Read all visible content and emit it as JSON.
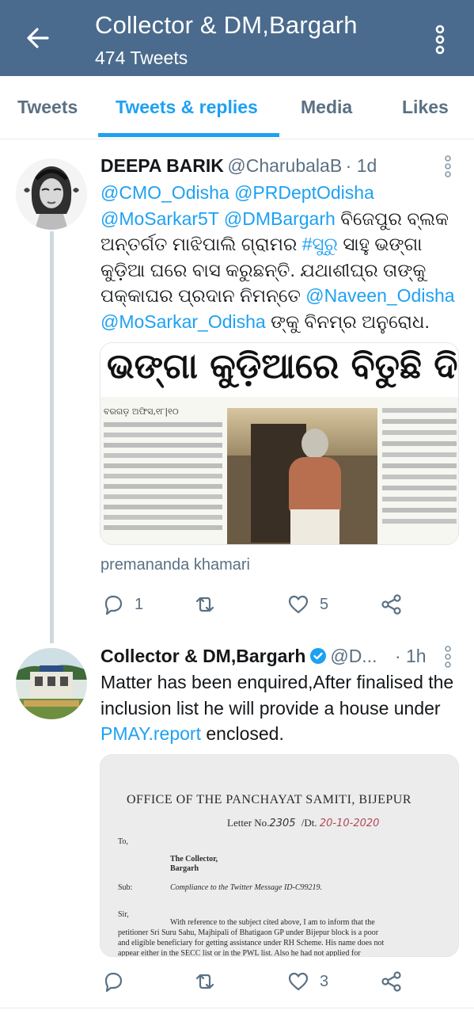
{
  "header": {
    "title": "Collector & DM,Bargarh",
    "subtitle": "474 Tweets"
  },
  "tabs": [
    {
      "label": "Tweets"
    },
    {
      "label": "Tweets & replies"
    },
    {
      "label": "Media"
    },
    {
      "label": "Likes"
    }
  ],
  "tweet1": {
    "name": "DEEPA BARIK",
    "handle": "@CharubalaB",
    "time": "· 1d",
    "body_parts": [
      {
        "text": "@CMO_Odisha",
        "link": true
      },
      {
        "text": " ",
        "link": false
      },
      {
        "text": "@PRDeptOdisha",
        "link": true
      },
      {
        "text": " ",
        "link": false
      },
      {
        "text": "@MoSarkar5T",
        "link": true
      },
      {
        "text": " ",
        "link": false
      },
      {
        "text": "@DMBargarh",
        "link": true
      },
      {
        "text": " ବିଜେପୁର ବ୍ଲକ ଅନ୍ତର୍ଗତ ମାଝିପାଲି ଗ୍ରାମର ",
        "link": false
      },
      {
        "text": "#ସୁରୁ",
        "link": true
      },
      {
        "text": " ସାହୁ ଭଙ୍ଗା କୁଡ଼ିଆ ଘରେ ବାସ କରୁଛନ୍ତି. ଯଥାଶୀଘ୍ର ତାଙ୍କୁ ପକ୍କାଘର ପ୍ରଦାନ ନିମନ୍ତେ ",
        "link": false
      },
      {
        "text": "@Naveen_Odisha",
        "link": true
      },
      {
        "text": " ",
        "link": false
      },
      {
        "text": "@MoSarkar_Odisha",
        "link": true
      },
      {
        "text": " ଙ୍କୁ ବିନମ୍ର ଅନୁରୋଧ.",
        "link": false
      }
    ],
    "image_headline": "ଭଙ୍ଗା କୁଡ଼ିଆରେ ବିତୁଛି ଦିନ",
    "image_dateline": "ବରଗଡ଼ ଅଫିସ,୧୮|୧୦",
    "caption": "premananda khamari",
    "replies": "1",
    "retweets": "",
    "likes": "5"
  },
  "tweet2": {
    "name": "Collector & DM,Bargarh",
    "handle": "@D...",
    "time": "· 1h",
    "body_parts": [
      {
        "text": "Matter has been enquired,After finalised the inclusion list he will provide a house under ",
        "link": false
      },
      {
        "text": "PMAY.report",
        "link": true
      },
      {
        "text": " enclosed.",
        "link": false
      }
    ],
    "doc": {
      "office": "OFFICE OF THE PANCHAYAT SAMITI, BIJEPUR",
      "letter": "Letter No.",
      "letter_no": "2305",
      "dt_label": "/Dt.",
      "dt_value": "20-10-2020",
      "to": "To,",
      "addr1": "The Collector,",
      "addr2": "Bargarh",
      "sub_label": "Sub:",
      "sub_text": "Compliance to the Twitter Message ID-C99219.",
      "sir": "Sir,",
      "para1": "With reference to the subject cited above, I am to inform that the",
      "para2": "petitioner Sri Suru Sahu, Majhipali of Bhatigaon GP under Bijepur block is a poor",
      "para3": "and eligible beneficiary for getting assistance under RH Scheme. His name does not",
      "para4": "appear either in the SECC list or in the PWL list. Also he had not applied for"
    },
    "replies": "",
    "retweets": "",
    "likes": "3"
  },
  "colors": {
    "header_bg": "#4a6b8d",
    "accent": "#1da1f2",
    "muted": "#5b7083",
    "verified": "#1da1f2"
  }
}
